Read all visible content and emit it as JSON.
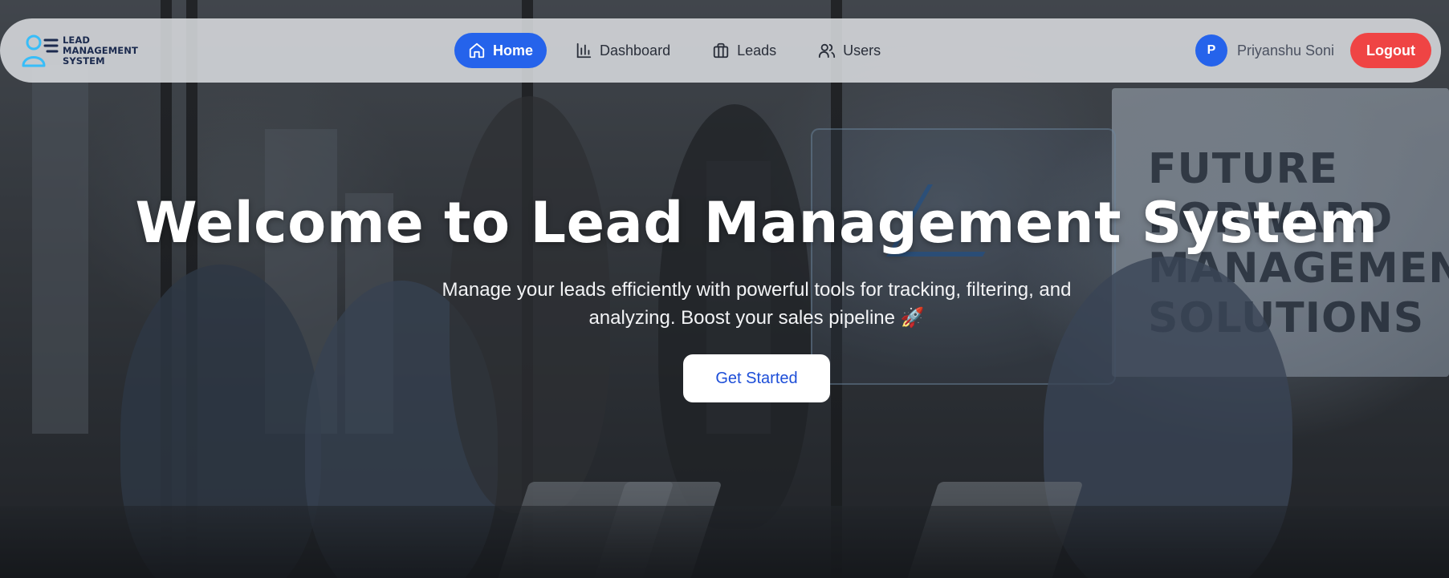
{
  "brand": {
    "line1": "LEAD",
    "line2": "MANAGEMENT",
    "line3": "SYSTEM",
    "icon": "user-list-icon"
  },
  "nav": {
    "items": [
      {
        "label": "Home",
        "icon": "home-icon",
        "active": true
      },
      {
        "label": "Dashboard",
        "icon": "bar-chart-icon",
        "active": false
      },
      {
        "label": "Leads",
        "icon": "briefcase-icon",
        "active": false
      },
      {
        "label": "Users",
        "icon": "users-icon",
        "active": false
      }
    ]
  },
  "user": {
    "avatar_initial": "P",
    "name": "Priyanshu Soni",
    "logout_label": "Logout"
  },
  "hero": {
    "title": "Welcome to Lead Management System",
    "subtitle_line1": "Manage your leads efficiently with powerful tools for tracking, filtering, and",
    "subtitle_line2": "analyzing. Boost your sales pipeline",
    "rocket": "🚀",
    "cta_label": "Get Started"
  },
  "background": {
    "screen_text": "FUTURE FORWARD MANAGEMENT SOLUTIONS"
  },
  "colors": {
    "primary": "#2563eb",
    "danger": "#ef4444",
    "brand_text": "#1b2a4e",
    "logo_accent": "#38bdf8"
  }
}
